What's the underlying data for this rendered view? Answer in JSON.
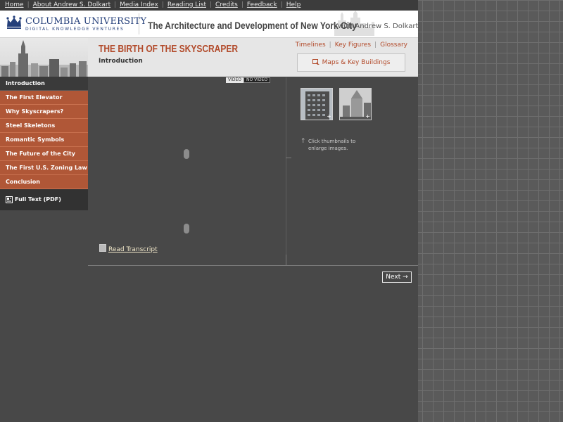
{
  "topnav": {
    "items": [
      "Home",
      "About Andrew S. Dolkart",
      "Media Index",
      "Reading List",
      "Credits",
      "Feedback",
      "Help"
    ],
    "separator": "|"
  },
  "header": {
    "university_name": "COLUMBIA UNIVERSITY",
    "university_sub": "DIGITAL KNOWLEDGE VENTURES",
    "course_title": "The Architecture and Development of New York City",
    "course_author": "with Andrew S. Dolkart",
    "logo_icon": "columbia-crown-icon"
  },
  "chapter": {
    "title": "THE BIRTH OF THE SKYSCRAPER",
    "section": "Introduction"
  },
  "toollinks": {
    "items": [
      "Timelines",
      "Key Figures",
      "Glossary"
    ],
    "separator": "|"
  },
  "maps_button": {
    "label": "Maps & Key Buildings",
    "icon": "map-pointer-icon"
  },
  "sidebar": {
    "items": [
      {
        "label": "Introduction",
        "active": true
      },
      {
        "label": "The First Elevator",
        "active": false
      },
      {
        "label": "Why Skyscrapers?",
        "active": false
      },
      {
        "label": "Steel Skeletons",
        "active": false
      },
      {
        "label": "Romantic Symbols",
        "active": false
      },
      {
        "label": "The Future of the City",
        "active": false
      },
      {
        "label": "The First U.S. Zoning Law",
        "active": false
      },
      {
        "label": "Conclusion",
        "active": false
      }
    ],
    "pdf_label": "Full Text (PDF)",
    "pdf_icon": "pdf-document-icon"
  },
  "video_toggle": {
    "video": "VIDEO",
    "no_video": "NO VIDEO",
    "selected": "NO VIDEO"
  },
  "thumbnails": {
    "hint": "Click thumbnails to enlarge images.",
    "items": [
      {
        "name": "building-thumbnail-1",
        "plus": "+"
      },
      {
        "name": "building-thumbnail-2",
        "plus": "+"
      }
    ]
  },
  "transcript": {
    "label": "Read Transcript",
    "icon": "transcript-icon"
  },
  "next_button": {
    "label": "Next",
    "icon": "arrow-right-icon"
  },
  "colors": {
    "accent": "#b24a2a",
    "sidebar_bg": "#b05737",
    "content_bg": "#484848",
    "univ_blue": "#243f7a"
  }
}
